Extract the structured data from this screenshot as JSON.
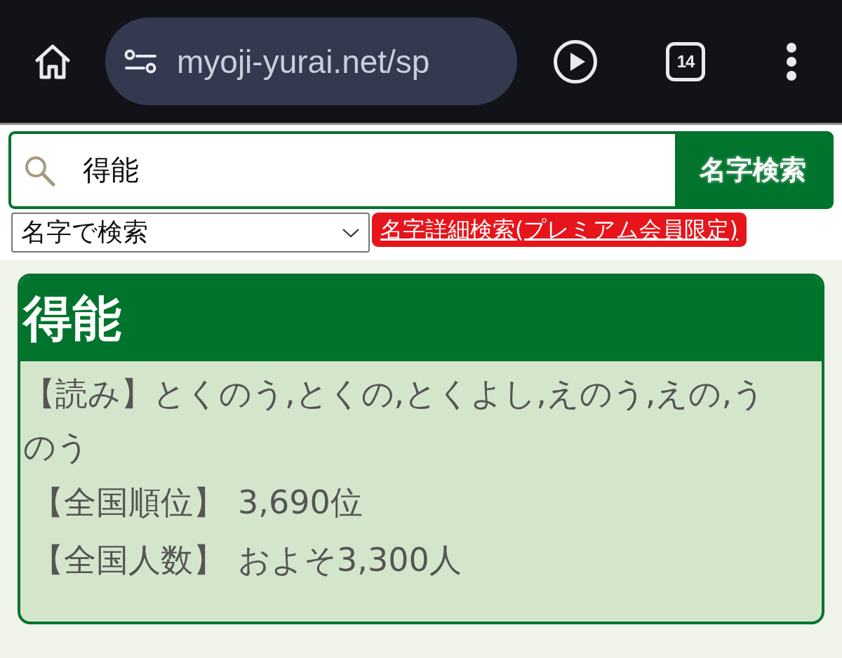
{
  "browser_bar": {
    "url": "myoji-yurai.net/sp",
    "tab_count": "14"
  },
  "search": {
    "value": "得能",
    "button": "名字検索"
  },
  "search_mode": {
    "value": "名字で検索"
  },
  "premium_link": "名字詳細検索(プレミアム会員限定)",
  "result": {
    "title": "得能",
    "reading": "【読み】とくのう,とくの,とくよし,えのう,えの,うのう",
    "facts": [
      {
        "label": "【全国順位】",
        "value": "3,690位"
      },
      {
        "label": "【全国人数】",
        "value": "およそ3,300人"
      }
    ]
  }
}
